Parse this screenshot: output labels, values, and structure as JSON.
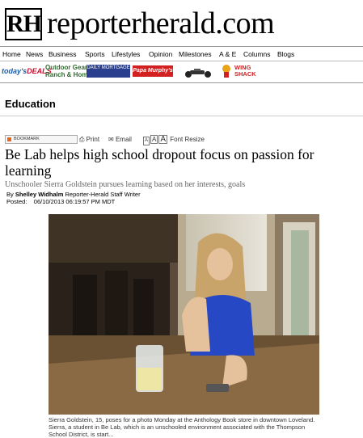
{
  "site": {
    "logo_text": "RH",
    "name": "reporterherald.com"
  },
  "nav": {
    "items": [
      "Home",
      "News",
      "Business",
      "Sports",
      "Lifestyles",
      "Opinion",
      "Milestones",
      "A & E",
      "Columns",
      "Blogs"
    ]
  },
  "deals": {
    "todays_prefix": "today's",
    "todays_suffix": "DEALS",
    "outdoor_gear": "Outdoor Gear",
    "outdoor_ranch": "Ranch & Home",
    "daily_mortgage": "DAILY MORTGAGE",
    "papa_murphys": "Papa Murphy's",
    "wing_shack_line1": "WING",
    "wing_shack_line2": "SHACK"
  },
  "section": {
    "title": "Education"
  },
  "tools": {
    "bookmark": "BOOKMARK",
    "print": "Print",
    "email": "Email",
    "font_a1": "A",
    "font_a2": "A",
    "font_a3": "A",
    "font_resize": "Font Resize"
  },
  "article": {
    "headline": "Be Lab helps high school dropout focus on passion for learning",
    "subhead": "Unschooler Sierra Goldstein pursues learning based on her interests, goals",
    "byline_prefix": "By",
    "author": "Shelley Widhalm",
    "author_role": "Reporter-Herald Staff Writer",
    "posted_label": "Posted:",
    "posted_date": "06/10/2013 06:19:57 PM MDT",
    "caption": "Sierra Goldstein, 15, poses for a photo Monday at the Anthology Book store in downtown Loveland. Sierra, a student in Be Lab, which is an unschooled environment associated with the Thompson School District, is start..."
  },
  "colors": {
    "deals_blue": "#1a5fb4",
    "deals_red": "#c8102e",
    "mortgage_blue": "#2b3f8f",
    "papa_red": "#d21f1f"
  }
}
